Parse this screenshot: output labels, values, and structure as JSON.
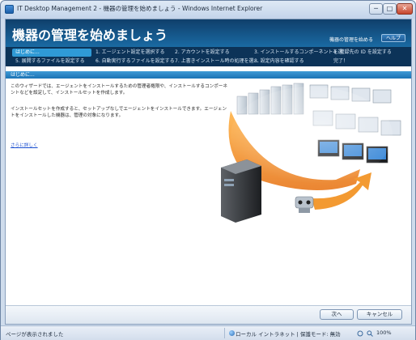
{
  "window": {
    "title": "IT Desktop Management 2 - 機器の管理を始めましょう - Windows Internet Explorer",
    "min_glyph": "─",
    "max_glyph": "□",
    "close_glyph": "✕"
  },
  "header": {
    "title": "機器の管理を始めましょう",
    "subtitle": "機器の管理を始める",
    "help_label": "ヘルプ"
  },
  "steps": [
    "はじめに...",
    "1. エージェント設定を選択する",
    "2. アカウントを設定する",
    "3. インストールするコンポーネントを選...",
    "4. 登録先の ID を設定する",
    "5. 展開するファイルを設定する",
    "6. 自動実行するファイルを設定する",
    "7. 上書きインストール時の処理を選...",
    "8. 設定内容を確認する",
    "完了！"
  ],
  "section": {
    "title": "はじめに..."
  },
  "body": {
    "para1": "このウィザードでは、エージェントをインストールするための管理者権限や、インストールするコンポーネントなどを設定して、インストールセットを作成します。",
    "para2": "インストールセットを作成すると、セットアップなしでエージェントをインストールできます。エージェントをインストールした機器は、管理の対象になります。",
    "more_link": "さらに詳しく"
  },
  "footer": {
    "next_label": "次へ",
    "cancel_label": "キャンセル"
  },
  "statusbar": {
    "left_text": "ページが表示されました",
    "zone_text": "ローカル イントラネット | 保護モード: 無効",
    "zoom_text": "100%"
  },
  "colors": {
    "header_blue": "#1a6aa3",
    "step_bar": "#0c3358",
    "active_step": "#2f9ad6",
    "arrow_orange": "#f39a32"
  }
}
